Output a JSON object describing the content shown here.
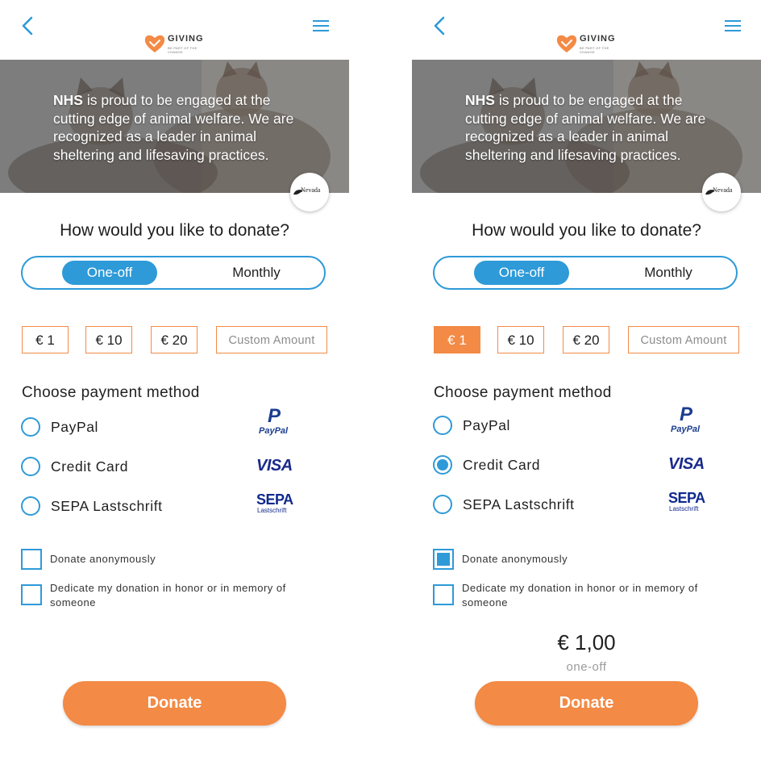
{
  "brand": {
    "name": "GIVING",
    "tagline": "BE PART OF THE CHANGE",
    "accent_color": "#f38a45",
    "primary_color": "#2e9ad8"
  },
  "org_badge_label": "Nevada",
  "hero": {
    "bold_prefix": "NHS",
    "text": " is proud to be engaged at the cutting edge of animal welfare. We are recognized as a leader in animal sheltering and lifesaving practices."
  },
  "question": "How would you like to donate?",
  "frequency": {
    "options": [
      "One-off",
      "Monthly"
    ]
  },
  "amounts": [
    "€ 1",
    "€ 10",
    "€ 20"
  ],
  "custom_amount_placeholder": "Custom Amount",
  "payment": {
    "title": "Choose payment method",
    "methods": [
      {
        "label": "PayPal",
        "logo": "paypal-logo"
      },
      {
        "label": "Credit Card",
        "logo": "visa-logo"
      },
      {
        "label": "SEPA Lastschrift",
        "logo": "sepa-logo"
      }
    ],
    "logos": {
      "paypal_word": "PayPal",
      "paypal_letter": "P",
      "visa_word": "VISA",
      "sepa_word": "SEPA",
      "sepa_sub": "Lastschrift"
    }
  },
  "options": {
    "anonymous": "Donate anonymously",
    "dedicate": "Dedicate my donation in honor or in memory of someone"
  },
  "summary": {
    "amount": "€ 1,00",
    "frequency": "one-off"
  },
  "donate_label": "Donate",
  "screens": [
    {
      "frequency": "One-off",
      "selected_amount": null,
      "payment_method": null,
      "anonymous": false,
      "dedicate": false,
      "show_summary": false
    },
    {
      "frequency": "One-off",
      "selected_amount": "€ 1",
      "payment_method": "Credit Card",
      "anonymous": true,
      "dedicate": false,
      "show_summary": true
    }
  ]
}
